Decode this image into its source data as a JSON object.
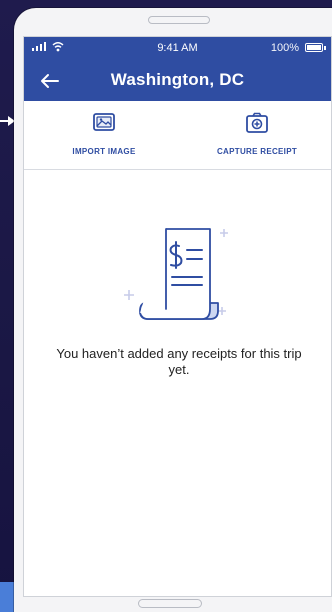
{
  "status_bar": {
    "time": "9:41 AM",
    "battery": "100%"
  },
  "header": {
    "title": "Washington, DC",
    "back_icon": "arrow-left-icon"
  },
  "actions": [
    {
      "label": "IMPORT IMAGE",
      "icon": "image-icon"
    },
    {
      "label": "CAPTURE RECEIPT",
      "icon": "camera-icon"
    }
  ],
  "empty_state": {
    "icon": "receipt-icon",
    "message": "You haven’t added any receipts for this trip yet."
  },
  "colors": {
    "brand": "#2f4da2",
    "background": "#1a1744",
    "accent": "#4a7ed8"
  }
}
